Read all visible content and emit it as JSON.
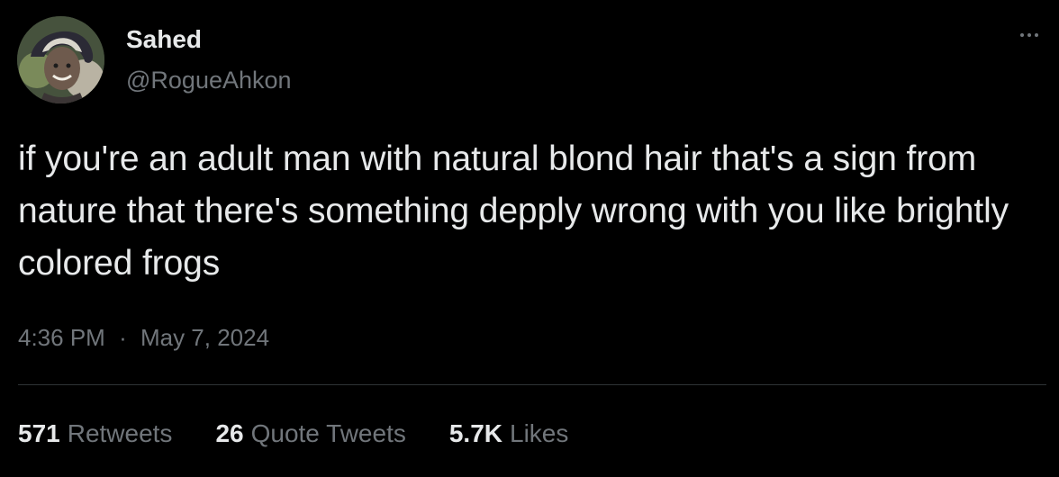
{
  "author": {
    "name": "Sahed",
    "handle": "@RogueAhkon"
  },
  "tweet": {
    "text": "if you're an adult man with natural blond hair that's a sign from nature that there's something depply wrong with you like brightly colored frogs",
    "time": "4:36 PM",
    "separator": "·",
    "date": "May 7, 2024"
  },
  "stats": {
    "retweets_count": "571",
    "retweets_label": "Retweets",
    "quotes_count": "26",
    "quotes_label": "Quote Tweets",
    "likes_count": "5.7K",
    "likes_label": "Likes"
  },
  "icons": {
    "more": "more-horizontal-icon"
  },
  "colors": {
    "background": "#000000",
    "primary_text": "#e7e9ea",
    "secondary_text": "#71767b",
    "divider": "#2f3336"
  }
}
